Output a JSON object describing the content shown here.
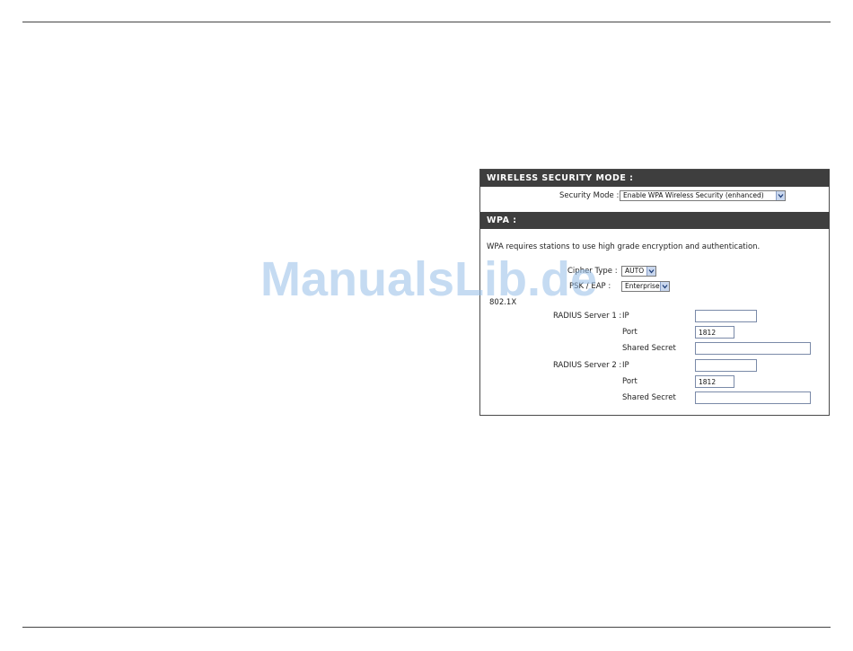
{
  "wireless_security_mode": {
    "header": "WIRELESS SECURITY MODE :",
    "security_mode_label": "Security Mode :",
    "security_mode_value": "Enable WPA Wireless Security (enhanced)"
  },
  "wpa": {
    "header": "WPA :",
    "description": "WPA requires stations to use high grade encryption and authentication.",
    "cipher_type_label": "Cipher Type :",
    "cipher_type_value": "AUTO",
    "psk_eap_label": "PSK / EAP :",
    "psk_eap_value": "Enterprise",
    "section_8021x": "802.1X",
    "radius1": {
      "label": "RADIUS Server 1 :",
      "ip_label": "IP",
      "ip_value": "",
      "port_label": "Port",
      "port_value": "1812",
      "secret_label": "Shared Secret",
      "secret_value": ""
    },
    "radius2": {
      "label": "RADIUS Server 2 :",
      "ip_label": "IP",
      "ip_value": "",
      "port_label": "Port",
      "port_value": "1812",
      "secret_label": "Shared Secret",
      "secret_value": ""
    }
  },
  "watermark": "ManualsLib.de",
  "colors": {
    "header_bg": "#3e3e3e",
    "header_text": "#ffffff",
    "watermark": "#96bee8"
  }
}
